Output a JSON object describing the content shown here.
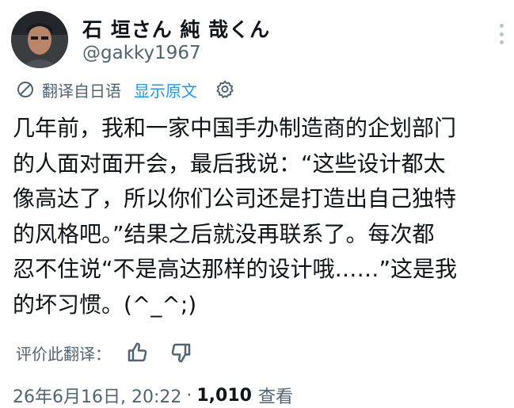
{
  "author": {
    "display_name": "石 垣さん 純 哉くん",
    "handle": "@gakky1967"
  },
  "translation": {
    "translated_from": "翻译自日语",
    "show_original": "显示原文"
  },
  "tweet": {
    "lines": [
      "几年前，我和一家中国手办制造商的企划部门",
      "的人面对面开会，最后我说：“这些设计都太",
      "像高达了，所以你们公司还是打造出自己独特",
      "的风格吧。”结果之后就没再联系了。每次都",
      "忍不住说“不是高达那样的设计哦……”这是我",
      "的坏习惯。(^_^;)"
    ]
  },
  "rating": {
    "label": "评价此翻译："
  },
  "meta": {
    "date": "26年6月16日, 20:22",
    "separator": "·",
    "view_count": "1,010",
    "views_label": "查看"
  },
  "icons": {
    "more": "more-vertical-icon",
    "translate": "translate-icon",
    "settings": "gear-icon",
    "thumbs_up": "thumbs-up-icon",
    "thumbs_down": "thumbs-down-icon"
  },
  "colors": {
    "text_primary": "#0f1419",
    "text_secondary": "#536471",
    "link": "#1d9bf0"
  }
}
